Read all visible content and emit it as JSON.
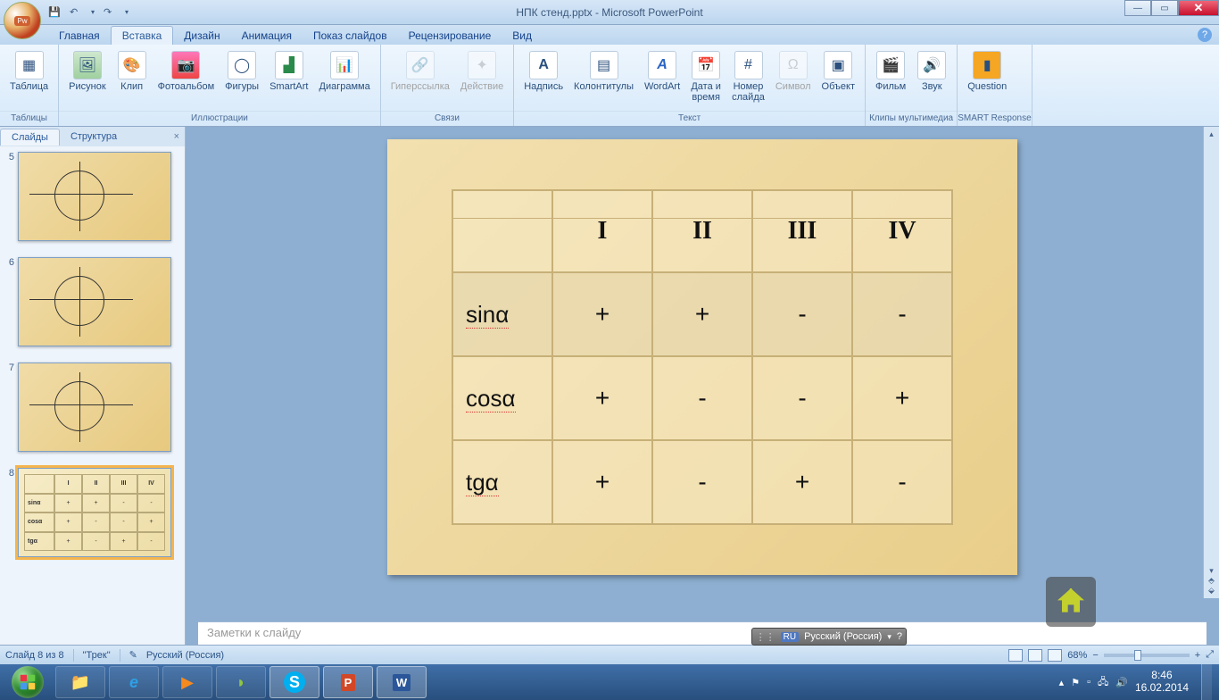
{
  "title": "НПК стенд.pptx - Microsoft PowerPoint",
  "qat": {
    "save": "💾",
    "undo": "↶",
    "redo": "↷"
  },
  "window_buttons": {
    "min": "—",
    "max": "▭",
    "close": "✕"
  },
  "tabs": {
    "home": "Главная",
    "insert": "Вставка",
    "design": "Дизайн",
    "animation": "Анимация",
    "slideshow": "Показ слайдов",
    "review": "Рецензирование",
    "view": "Вид"
  },
  "ribbon": {
    "tables": {
      "group": "Таблицы",
      "table": "Таблица"
    },
    "illustrations": {
      "group": "Иллюстрации",
      "picture": "Рисунок",
      "clip": "Клип",
      "album": "Фотоальбом",
      "shapes": "Фигуры",
      "smartart": "SmartArt",
      "chart": "Диаграмма"
    },
    "links": {
      "group": "Связи",
      "hyperlink": "Гиперссылка",
      "action": "Действие"
    },
    "text": {
      "group": "Текст",
      "textbox": "Надпись",
      "headerfooter": "Колонтитулы",
      "wordart": "WordArt",
      "datetime": "Дата и\nвремя",
      "slidenum": "Номер\nслайда",
      "symbol": "Символ",
      "object": "Объект"
    },
    "media": {
      "group": "Клипы мультимедиа",
      "movie": "Фильм",
      "sound": "Звук"
    },
    "smart": {
      "group": "SMART Response",
      "question": "Question"
    }
  },
  "slides_panel": {
    "tab_slides": "Слайды",
    "tab_outline": "Структура",
    "nums": [
      "5",
      "6",
      "7",
      "8"
    ]
  },
  "slide": {
    "headers": [
      "",
      "I",
      "II",
      "III",
      "IV"
    ],
    "rows": [
      {
        "name": "sinα",
        "vals": [
          "+",
          "+",
          "-",
          "-"
        ]
      },
      {
        "name": "cosα",
        "vals": [
          "+",
          "-",
          "-",
          "+"
        ]
      },
      {
        "name": "tgα",
        "vals": [
          "+",
          "-",
          "+",
          "-"
        ]
      }
    ]
  },
  "notes_placeholder": "Заметки к слайду",
  "status": {
    "slide_of": "Слайд 8 из 8",
    "theme": "\"Трек\"",
    "lang": "Русский (Россия)",
    "zoom": "68%"
  },
  "langbar": {
    "code": "RU",
    "name": "Русский (Россия)"
  },
  "tray": {
    "time": "8:46",
    "date": "16.02.2014"
  }
}
